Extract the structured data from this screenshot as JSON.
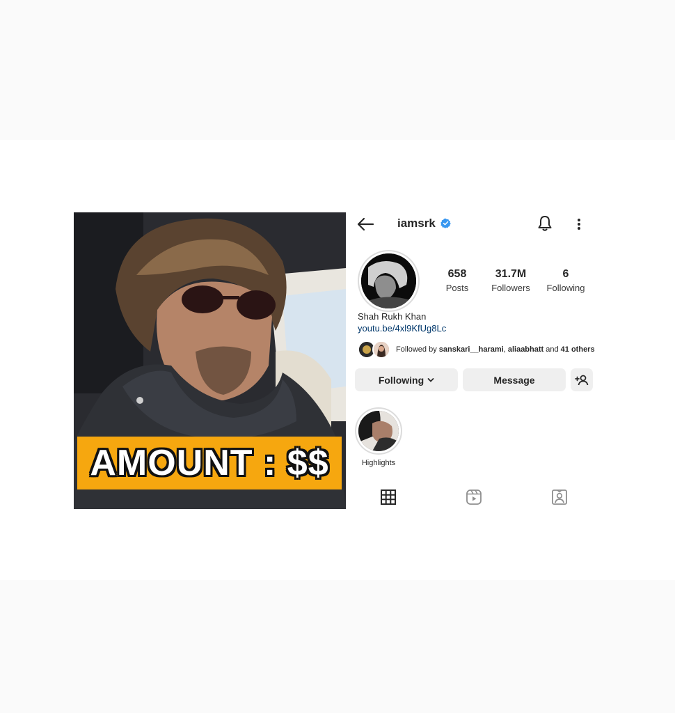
{
  "thumbnail": {
    "banner_text": "AMOUNT : $$",
    "banner_color": "#f6a70f"
  },
  "profile": {
    "username": "iamsrk",
    "verified": true,
    "verified_color": "#3897f0",
    "stats": {
      "posts_value": "658",
      "posts_label": "Posts",
      "followers_value": "31.7M",
      "followers_label": "Followers",
      "following_value": "6",
      "following_label": "Following"
    },
    "full_name": "Shah Rukh Khan",
    "link": "youtu.be/4xl9KfUg8Lc",
    "followed_by": {
      "prefix": "Followed by ",
      "user1": "sanskari__harami",
      "sep": ", ",
      "user2": "aliaabhatt",
      "and": " and ",
      "others": "41 others"
    },
    "buttons": {
      "following_label": "Following",
      "message_label": "Message"
    },
    "highlight": {
      "label": "Highlights"
    },
    "icons": [
      "back-arrow-icon",
      "verified-icon",
      "bell-icon",
      "more-icon",
      "add-user-icon",
      "chevron-down-icon",
      "grid-icon",
      "reels-icon",
      "tagged-icon"
    ]
  }
}
